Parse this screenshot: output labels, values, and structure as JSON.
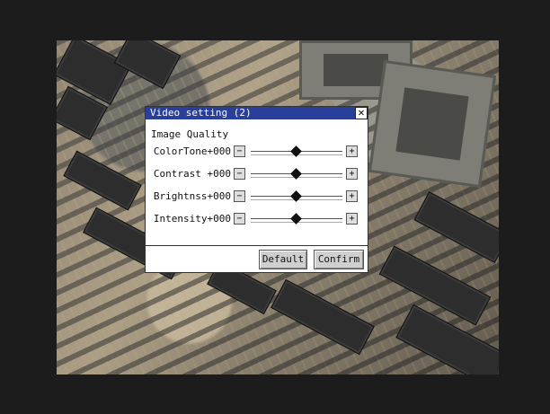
{
  "dialog": {
    "title": "Video setting (2)",
    "close_glyph": "✕",
    "section_label": "Image Quality",
    "rows": [
      {
        "label": "ColorTone+000",
        "minus": "−",
        "plus": "+",
        "level": 0.5
      },
      {
        "label": "Contrast +000",
        "minus": "−",
        "plus": "+",
        "level": 0.5
      },
      {
        "label": "Brightnss+000",
        "minus": "−",
        "plus": "+",
        "level": 0.5
      },
      {
        "label": "Intensity+000",
        "minus": "−",
        "plus": "+",
        "level": 0.5
      }
    ],
    "default_label": "Default",
    "confirm_label": "Confirm"
  },
  "colors": {
    "titlebar": "#2a3f9a",
    "dialog_bg": "#ffffff",
    "screen_frame": "#1c1c1c"
  }
}
